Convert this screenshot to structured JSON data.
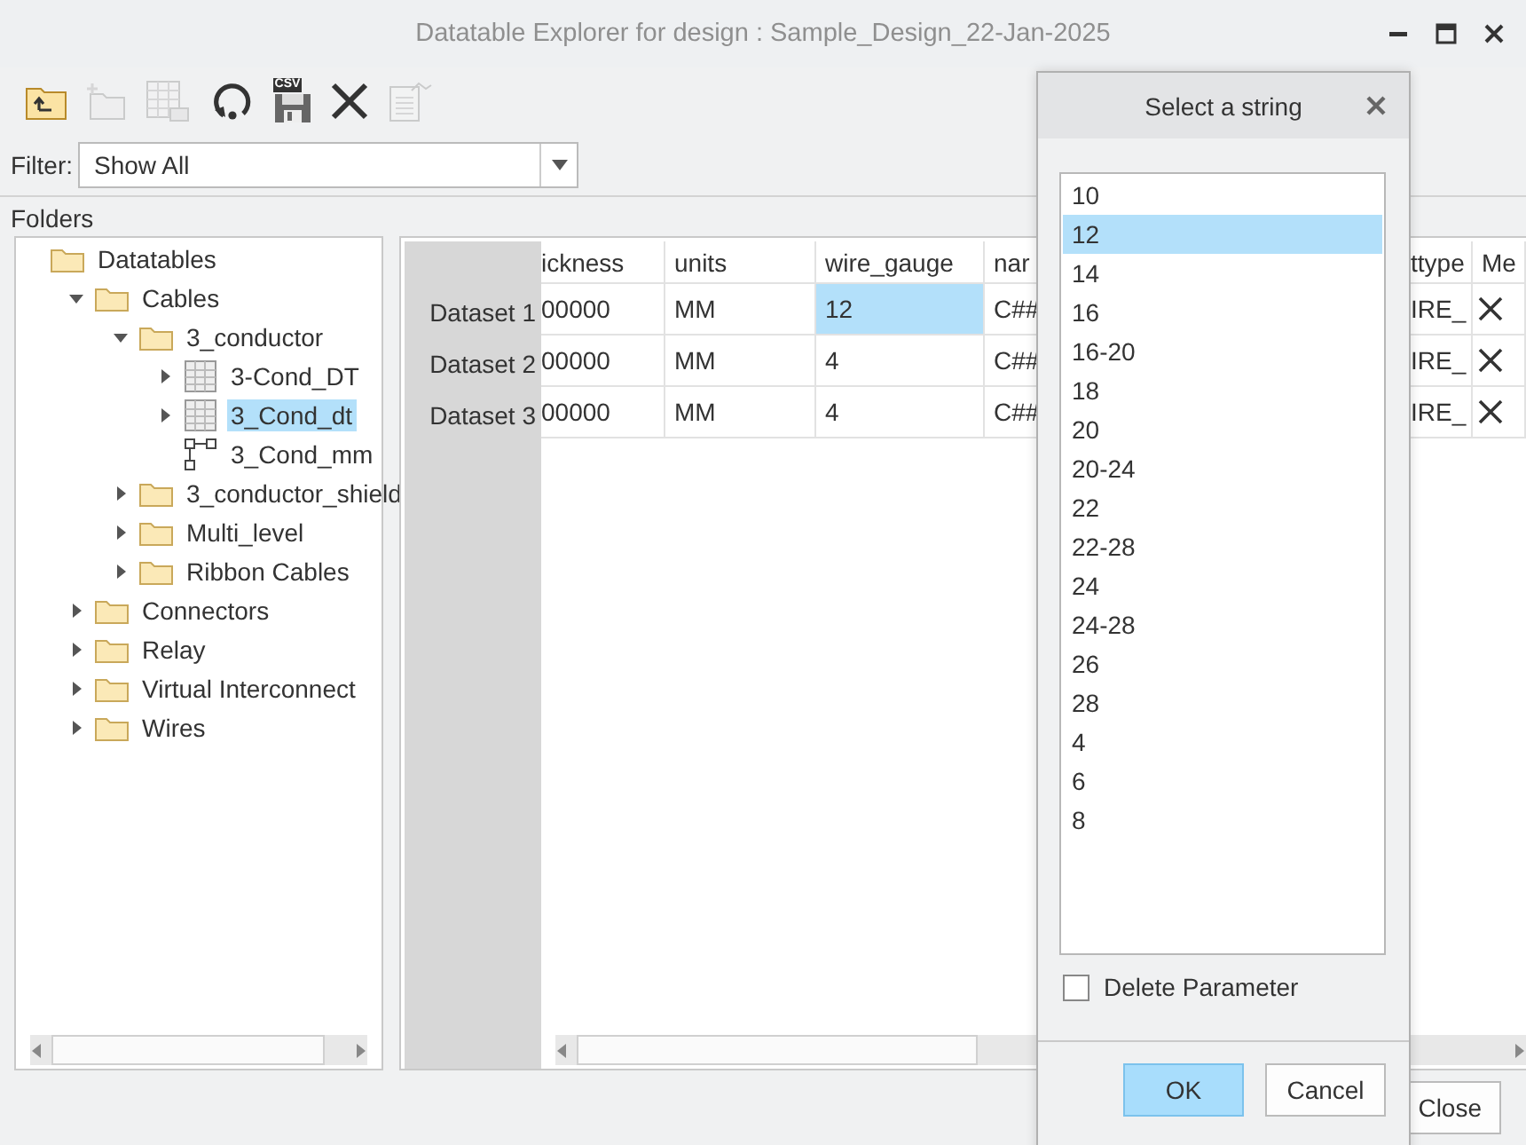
{
  "window": {
    "title": "Datatable Explorer for design : Sample_Design_22-Jan-2025"
  },
  "toolbar": [
    {
      "disabled": false
    },
    {
      "disabled": true
    },
    {
      "disabled": true
    },
    {
      "disabled": false
    },
    {
      "label": "CSV",
      "disabled": false
    },
    {
      "disabled": false
    },
    {
      "disabled": true
    }
  ],
  "filter": {
    "label": "Filter:",
    "value": "Show All"
  },
  "folders_label": "Folders",
  "tree": [
    {
      "label": "Datatables",
      "kind": "folder",
      "selected": false,
      "children": [
        {
          "label": "Cables",
          "kind": "folder",
          "expanded": true,
          "selected": false,
          "children": [
            {
              "label": "3_conductor",
              "kind": "folder",
              "expanded": true,
              "selected": false,
              "children": [
                {
                  "label": "3-Cond_DT",
                  "kind": "table",
                  "expanded": false,
                  "selected": false
                },
                {
                  "label": "3_Cond_dt",
                  "kind": "table",
                  "expanded": false,
                  "selected": true
                },
                {
                  "label": "3_Cond_mm",
                  "kind": "model",
                  "selected": false
                }
              ]
            },
            {
              "label": "3_conductor_shield",
              "kind": "folder",
              "expanded": false,
              "selected": false
            },
            {
              "label": "Multi_level",
              "kind": "folder",
              "expanded": false,
              "selected": false
            },
            {
              "label": "Ribbon Cables",
              "kind": "folder",
              "expanded": false,
              "selected": false
            }
          ]
        },
        {
          "label": "Connectors",
          "kind": "folder",
          "expanded": false,
          "selected": false
        },
        {
          "label": "Relay",
          "kind": "folder",
          "expanded": false,
          "selected": false
        },
        {
          "label": "Virtual Interconnect",
          "kind": "folder",
          "expanded": false,
          "selected": false
        },
        {
          "label": "Wires",
          "kind": "folder",
          "expanded": false,
          "selected": false
        }
      ]
    }
  ],
  "table": {
    "columns": [
      "ickness",
      "units",
      "wire_gauge",
      "nar",
      "ttype",
      "Me"
    ],
    "rows": [
      {
        "header": "Dataset 1",
        "cells": [
          {
            "text": "00000",
            "selected": false
          },
          {
            "text": "MM",
            "selected": false
          },
          {
            "text": "12",
            "selected": true
          },
          {
            "text": "C##",
            "selected": false
          },
          {
            "text": "IRE_",
            "selected": false
          }
        ]
      },
      {
        "header": "Dataset 2",
        "cells": [
          {
            "text": "00000",
            "selected": false
          },
          {
            "text": "MM",
            "selected": false
          },
          {
            "text": "4",
            "selected": false
          },
          {
            "text": "C##",
            "selected": false
          },
          {
            "text": "IRE_",
            "selected": false
          }
        ]
      },
      {
        "header": "Dataset 3",
        "cells": [
          {
            "text": "00000",
            "selected": false
          },
          {
            "text": "MM",
            "selected": false
          },
          {
            "text": "4",
            "selected": false
          },
          {
            "text": "C##",
            "selected": false
          },
          {
            "text": "IRE_",
            "selected": false
          }
        ]
      }
    ]
  },
  "buttons": [
    "Close"
  ],
  "dialog": {
    "title": "Select a string",
    "options": [
      {
        "label": "10",
        "selected": false
      },
      {
        "label": "12",
        "selected": true
      },
      {
        "label": "14",
        "selected": false
      },
      {
        "label": "16",
        "selected": false
      },
      {
        "label": "16-20",
        "selected": false
      },
      {
        "label": "18",
        "selected": false
      },
      {
        "label": "20",
        "selected": false
      },
      {
        "label": "20-24",
        "selected": false
      },
      {
        "label": "22",
        "selected": false
      },
      {
        "label": "22-28",
        "selected": false
      },
      {
        "label": "24",
        "selected": false
      },
      {
        "label": "24-28",
        "selected": false
      },
      {
        "label": "26",
        "selected": false
      },
      {
        "label": "28",
        "selected": false
      },
      {
        "label": "4",
        "selected": false
      },
      {
        "label": "6",
        "selected": false
      },
      {
        "label": "8",
        "selected": false
      }
    ],
    "checkbox": {
      "label": "Delete Parameter",
      "checked": false
    },
    "buttons": [
      {
        "label": "OK",
        "primary": true
      },
      {
        "label": "Cancel",
        "primary": false
      }
    ]
  }
}
